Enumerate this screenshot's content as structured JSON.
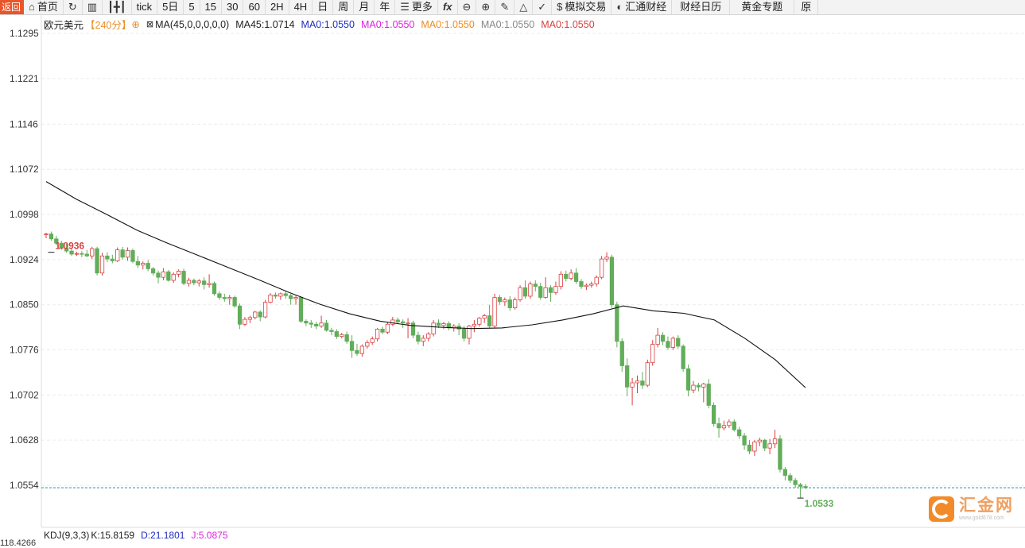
{
  "toolbar": {
    "back": "返回",
    "home": "首页",
    "tick": "tick",
    "five_day": "5日",
    "periods": [
      "5",
      "15",
      "30",
      "60",
      "2H",
      "4H",
      "日",
      "周",
      "月",
      "年"
    ],
    "more": "更多",
    "sim_trade": "模拟交易",
    "fx678": "汇通财经",
    "calendar": "财经日历",
    "gold": "黄金专题",
    "last": "原"
  },
  "legend": {
    "symbol": "欧元美元",
    "period": "【240分】",
    "ma_params": "MA(45,0,0,0,0,0)",
    "ma45": "MA45:1.0714",
    "ma0_values": [
      "MA0:1.0550",
      "MA0:1.0550",
      "MA0:1.0550",
      "MA0:1.0550",
      "MA0:1.0550"
    ],
    "ma0_colors": [
      "#1f2dbf",
      "#e020e0",
      "#f08a1e",
      "#888888",
      "#d94040"
    ]
  },
  "indicator": {
    "label": "KDJ(9,3,3)",
    "k": "K:15.8159",
    "d": "D:21.1801",
    "j": "J:5.0875"
  },
  "bottom_axis_label": "118.4266",
  "logo": {
    "name": "汇金网",
    "url": "www.gold678.com"
  },
  "colors": {
    "up": "#d94040",
    "down": "#62ad5a",
    "ma45": "#111111",
    "last_price_line": "#2a8fa0"
  },
  "chart_data": {
    "type": "candlestick",
    "title": "欧元美元",
    "y_ticks": [
      "1.1295",
      "1.1221",
      "1.1146",
      "1.1072",
      "1.0998",
      "1.0924",
      "1.0850",
      "1.0776",
      "1.0702",
      "1.0628",
      "1.0554"
    ],
    "ylim": [
      1.0541,
      1.1295
    ],
    "high_label": "1.0936",
    "low_label": "1.0533",
    "last_price": 1.055,
    "series": [
      {
        "name": "MA45",
        "values": [
          1.1052,
          1.1023,
          1.0998,
          1.0972,
          1.0951,
          1.0931,
          1.0911,
          1.0891,
          1.087,
          1.0851,
          1.0835,
          1.0823,
          1.0816,
          1.0813,
          1.0811,
          1.0812,
          1.0817,
          1.0825,
          1.0835,
          1.0848,
          1.084,
          1.0836,
          1.0825,
          1.0795,
          1.076,
          1.0714
        ]
      }
    ],
    "candles": [
      [
        1.0965,
        1.0968,
        1.0959,
        1.0966
      ],
      [
        1.0966,
        1.097,
        1.0955,
        1.0958
      ],
      [
        1.0958,
        1.0963,
        1.0948,
        1.0951
      ],
      [
        1.0951,
        1.0955,
        1.094,
        1.0943
      ],
      [
        1.0943,
        1.095,
        1.0935,
        1.0938
      ],
      [
        1.0938,
        1.0942,
        1.093,
        1.0933
      ],
      [
        1.0933,
        1.0937,
        1.093,
        1.0934
      ],
      [
        1.0934,
        1.0938,
        1.0928,
        1.0933
      ],
      [
        1.0933,
        1.094,
        1.0928,
        1.093
      ],
      [
        1.093,
        1.0945,
        1.0925,
        1.0942
      ],
      [
        1.0942,
        1.0945,
        1.0898,
        1.0902
      ],
      [
        1.0902,
        1.0935,
        1.0898,
        1.093
      ],
      [
        1.093,
        1.0936,
        1.092,
        1.0925
      ],
      [
        1.0925,
        1.0932,
        1.0918,
        1.0922
      ],
      [
        1.0922,
        1.0944,
        1.092,
        1.094
      ],
      [
        1.094,
        1.0945,
        1.0924,
        1.0928
      ],
      [
        1.0928,
        1.0944,
        1.0922,
        1.0939
      ],
      [
        1.0939,
        1.0942,
        1.0918,
        1.0921
      ],
      [
        1.0921,
        1.093,
        1.091,
        1.0915
      ],
      [
        1.0915,
        1.0921,
        1.0908,
        1.0918
      ],
      [
        1.0918,
        1.0923,
        1.0905,
        1.0909
      ],
      [
        1.0909,
        1.0912,
        1.0898,
        1.0902
      ],
      [
        1.0902,
        1.0906,
        1.0885,
        1.0895
      ],
      [
        1.0895,
        1.091,
        1.089,
        1.0904
      ],
      [
        1.0904,
        1.0907,
        1.0888,
        1.089
      ],
      [
        1.089,
        1.0903,
        1.0886,
        1.09
      ],
      [
        1.09,
        1.0908,
        1.0895,
        1.0905
      ],
      [
        1.0905,
        1.0909,
        1.0882,
        1.0885
      ],
      [
        1.0885,
        1.0894,
        1.088,
        1.089
      ],
      [
        1.089,
        1.0893,
        1.0882,
        1.0886
      ],
      [
        1.0886,
        1.0892,
        1.088,
        1.0889
      ],
      [
        1.0889,
        1.0895,
        1.0875,
        1.0883
      ],
      [
        1.0883,
        1.09,
        1.0878,
        1.0885
      ],
      [
        1.0885,
        1.0888,
        1.0865,
        1.0868
      ],
      [
        1.0868,
        1.0872,
        1.0858,
        1.0862
      ],
      [
        1.0862,
        1.0868,
        1.0855,
        1.086
      ],
      [
        1.086,
        1.0866,
        1.085,
        1.0862
      ],
      [
        1.0862,
        1.0865,
        1.0845,
        1.0848
      ],
      [
        1.0848,
        1.0852,
        1.081,
        1.0818
      ],
      [
        1.0818,
        1.083,
        1.0815,
        1.0826
      ],
      [
        1.0826,
        1.0832,
        1.082,
        1.0829
      ],
      [
        1.0829,
        1.084,
        1.0826,
        1.0838
      ],
      [
        1.0838,
        1.0841,
        1.0823,
        1.083
      ],
      [
        1.083,
        1.0858,
        1.0828,
        1.0854
      ],
      [
        1.0854,
        1.0869,
        1.0852,
        1.0866
      ],
      [
        1.0866,
        1.087,
        1.086,
        1.0864
      ],
      [
        1.0864,
        1.087,
        1.0858,
        1.0868
      ],
      [
        1.0868,
        1.0872,
        1.086,
        1.0865
      ],
      [
        1.0865,
        1.0868,
        1.085,
        1.086
      ],
      [
        1.086,
        1.0865,
        1.085,
        1.0862
      ],
      [
        1.0862,
        1.0864,
        1.082,
        1.0823
      ],
      [
        1.0823,
        1.0826,
        1.0815,
        1.082
      ],
      [
        1.082,
        1.0825,
        1.0812,
        1.0818
      ],
      [
        1.0818,
        1.0822,
        1.081,
        1.0815
      ],
      [
        1.0815,
        1.0832,
        1.0812,
        1.082
      ],
      [
        1.082,
        1.0825,
        1.0806,
        1.0808
      ],
      [
        1.0808,
        1.0812,
        1.08,
        1.0806
      ],
      [
        1.0806,
        1.081,
        1.0794,
        1.0798
      ],
      [
        1.0798,
        1.0804,
        1.0795,
        1.0801
      ],
      [
        1.0801,
        1.0806,
        1.0786,
        1.079
      ],
      [
        1.079,
        1.08,
        1.0763,
        1.0775
      ],
      [
        1.0775,
        1.0786,
        1.0766,
        1.077
      ],
      [
        1.077,
        1.0785,
        1.0765,
        1.0782
      ],
      [
        1.0782,
        1.0792,
        1.0778,
        1.0788
      ],
      [
        1.0788,
        1.0798,
        1.0784,
        1.0794
      ],
      [
        1.0794,
        1.0812,
        1.079,
        1.081
      ],
      [
        1.081,
        1.0814,
        1.0802,
        1.0805
      ],
      [
        1.0805,
        1.0822,
        1.0802,
        1.0818
      ],
      [
        1.0818,
        1.083,
        1.0815,
        1.0825
      ],
      [
        1.0825,
        1.0829,
        1.0818,
        1.0822
      ],
      [
        1.0822,
        1.0826,
        1.0812,
        1.082
      ],
      [
        1.082,
        1.0828,
        1.0795,
        1.082
      ],
      [
        1.082,
        1.0824,
        1.0795,
        1.08
      ],
      [
        1.08,
        1.0806,
        1.0785,
        1.079
      ],
      [
        1.079,
        1.08,
        1.0782,
        1.0795
      ],
      [
        1.0795,
        1.0805,
        1.079,
        1.0802
      ],
      [
        1.0802,
        1.0825,
        1.0798,
        1.082
      ],
      [
        1.082,
        1.0826,
        1.0812,
        1.0816
      ],
      [
        1.0816,
        1.0822,
        1.081,
        1.0819
      ],
      [
        1.0819,
        1.0823,
        1.0808,
        1.0812
      ],
      [
        1.0812,
        1.0818,
        1.0806,
        1.0815
      ],
      [
        1.0815,
        1.082,
        1.08,
        1.081
      ],
      [
        1.081,
        1.0815,
        1.079,
        1.0795
      ],
      [
        1.0795,
        1.0817,
        1.0785,
        1.0815
      ],
      [
        1.0815,
        1.0825,
        1.0805,
        1.0818
      ],
      [
        1.0818,
        1.083,
        1.0814,
        1.0828
      ],
      [
        1.0828,
        1.0835,
        1.082,
        1.0832
      ],
      [
        1.0832,
        1.085,
        1.0812,
        1.0815
      ],
      [
        1.0815,
        1.0868,
        1.0812,
        1.0862
      ],
      [
        1.0862,
        1.0866,
        1.085,
        1.0855
      ],
      [
        1.0855,
        1.0862,
        1.0848,
        1.0858
      ],
      [
        1.0858,
        1.0864,
        1.084,
        1.0845
      ],
      [
        1.0845,
        1.0862,
        1.0842,
        1.0858
      ],
      [
        1.0858,
        1.0882,
        1.0855,
        1.0878
      ],
      [
        1.0878,
        1.089,
        1.086,
        1.0864
      ],
      [
        1.0864,
        1.0888,
        1.086,
        1.0884
      ],
      [
        1.0884,
        1.089,
        1.0872,
        1.088
      ],
      [
        1.088,
        1.0886,
        1.0858,
        1.0862
      ],
      [
        1.0862,
        1.0895,
        1.086,
        1.0878
      ],
      [
        1.0878,
        1.0882,
        1.0855,
        1.087
      ],
      [
        1.087,
        1.0888,
        1.0866,
        1.088
      ],
      [
        1.088,
        1.0905,
        1.0875,
        1.09
      ],
      [
        1.09,
        1.0906,
        1.0888,
        1.0893
      ],
      [
        1.0893,
        1.0908,
        1.089,
        1.0902
      ],
      [
        1.0902,
        1.091,
        1.0884,
        1.0888
      ],
      [
        1.0888,
        1.0892,
        1.0876,
        1.088
      ],
      [
        1.088,
        1.0885,
        1.0874,
        1.0882
      ],
      [
        1.0882,
        1.0888,
        1.0878,
        1.0884
      ],
      [
        1.0884,
        1.0898,
        1.088,
        1.0895
      ],
      [
        1.0895,
        1.093,
        1.0892,
        1.0925
      ],
      [
        1.0925,
        1.0936,
        1.092,
        1.0928
      ],
      [
        1.0928,
        1.0932,
        1.0845,
        1.085
      ],
      [
        1.085,
        1.0855,
        1.078,
        1.079
      ],
      [
        1.079,
        1.0795,
        1.074,
        1.075
      ],
      [
        1.075,
        1.0762,
        1.07,
        1.0715
      ],
      [
        1.0715,
        1.073,
        1.0685,
        1.0722
      ],
      [
        1.0722,
        1.0734,
        1.0705,
        1.0725
      ],
      [
        1.0725,
        1.074,
        1.0712,
        1.0718
      ],
      [
        1.0718,
        1.076,
        1.0715,
        1.0755
      ],
      [
        1.0755,
        1.0792,
        1.075,
        1.0785
      ],
      [
        1.0785,
        1.0812,
        1.078,
        1.08
      ],
      [
        1.08,
        1.0805,
        1.0784,
        1.079
      ],
      [
        1.079,
        1.0798,
        1.0776,
        1.078
      ],
      [
        1.078,
        1.0798,
        1.0776,
        1.0795
      ],
      [
        1.0795,
        1.08,
        1.0778,
        1.0782
      ],
      [
        1.0782,
        1.0785,
        1.074,
        1.0745
      ],
      [
        1.0745,
        1.0752,
        1.07,
        1.071
      ],
      [
        1.071,
        1.0725,
        1.0705,
        1.0718
      ],
      [
        1.0718,
        1.0722,
        1.0708,
        1.0715
      ],
      [
        1.0715,
        1.0722,
        1.069,
        1.072
      ],
      [
        1.072,
        1.0728,
        1.068,
        1.0685
      ],
      [
        1.0685,
        1.069,
        1.065,
        1.0655
      ],
      [
        1.0655,
        1.0665,
        1.0632,
        1.0648
      ],
      [
        1.0648,
        1.066,
        1.0644,
        1.0652
      ],
      [
        1.0652,
        1.0662,
        1.0648,
        1.0658
      ],
      [
        1.0658,
        1.0662,
        1.0642,
        1.0645
      ],
      [
        1.0645,
        1.065,
        1.063,
        1.0635
      ],
      [
        1.0635,
        1.064,
        1.0612,
        1.062
      ],
      [
        1.062,
        1.0628,
        1.0605,
        1.061
      ],
      [
        1.061,
        1.0628,
        1.0602,
        1.0625
      ],
      [
        1.0625,
        1.0632,
        1.0618,
        1.0628
      ],
      [
        1.0628,
        1.063,
        1.061,
        1.0615
      ],
      [
        1.0615,
        1.063,
        1.0605,
        1.0622
      ],
      [
        1.0622,
        1.0645,
        1.0615,
        1.063
      ],
      [
        1.063,
        1.0636,
        1.0575,
        1.058
      ],
      [
        1.058,
        1.0584,
        1.0562,
        1.057
      ],
      [
        1.057,
        1.0574,
        1.0558,
        1.0562
      ],
      [
        1.0562,
        1.0566,
        1.055,
        1.0555
      ],
      [
        1.0555,
        1.0558,
        1.0533,
        1.0552
      ],
      [
        1.0552,
        1.0556,
        1.0548,
        1.055
      ]
    ]
  }
}
